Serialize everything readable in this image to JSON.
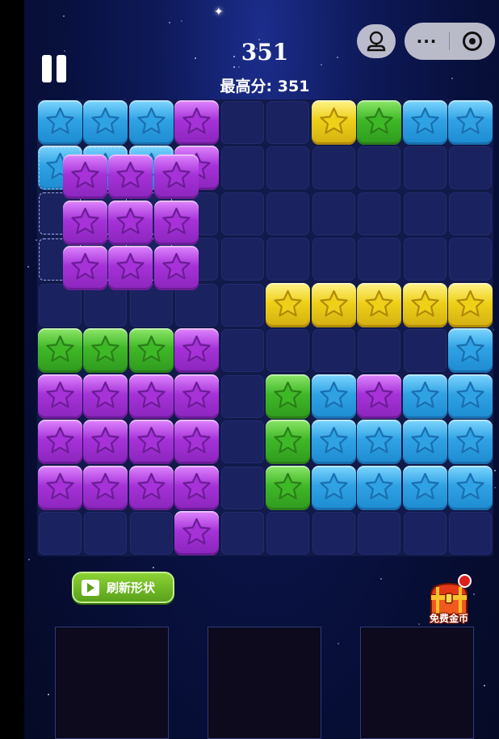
{
  "header": {
    "score": "351",
    "best_score_label": "最高分:",
    "best_score_value": "351"
  },
  "buttons": {
    "refresh_shape_label": "刷新形状",
    "free_coins_label": "免费金币",
    "more_label": "···"
  },
  "colors": {
    "blue": "#3fb4ec",
    "green": "#4ec93a",
    "purple": "#b43ee0",
    "yellow": "#f2dc1e",
    "empty": "#1a2260"
  },
  "board": {
    "size": 10,
    "rows": [
      "BBBP..YGBB",
      "BBBP......",
      "..........",
      "..........",
      ".....YYYYY",
      "GGGP.....B",
      "PPPP.GBPBB",
      "PPPP.GBBBB",
      "PPPP.GBBBB",
      "...P......"
    ],
    "dragging_piece": {
      "color": "purple",
      "shape": "3x3 square",
      "cells": [
        [
          1,
          0
        ],
        [
          1,
          1
        ],
        [
          1,
          2
        ],
        [
          2,
          0
        ],
        [
          2,
          1
        ],
        [
          2,
          2
        ],
        [
          3,
          0
        ],
        [
          3,
          1
        ],
        [
          3,
          2
        ]
      ]
    }
  },
  "tray": {
    "slots": 3
  },
  "icons": {
    "pause": "pause-icon",
    "gamepad": "gamepad-icon",
    "more": "more-dots-icon",
    "close": "target-circle-icon",
    "video": "play-video-icon",
    "chest": "treasure-chest-icon"
  }
}
